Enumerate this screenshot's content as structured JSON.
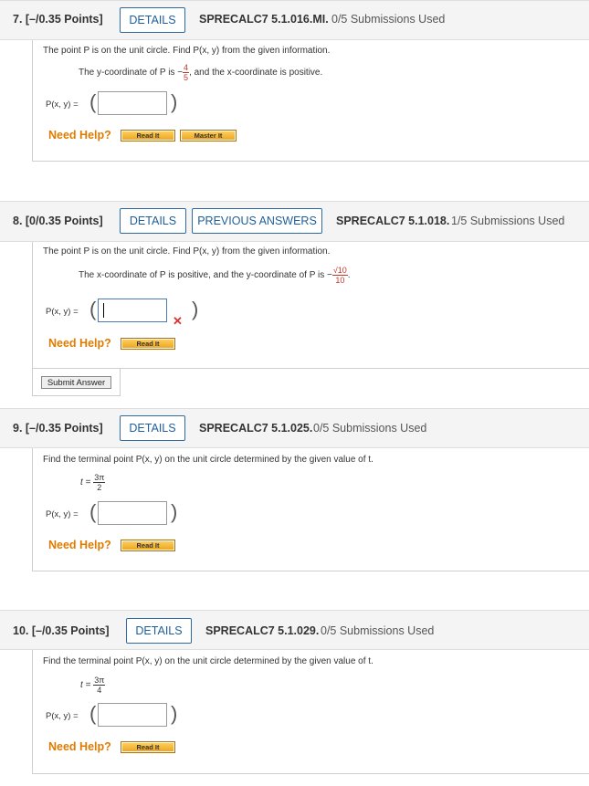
{
  "questions": [
    {
      "number": "7. [–/0.35 Points]",
      "details": "DETAILS",
      "code": "SPRECALC7 5.1.016.MI.",
      "submissions": "0/5 Submissions Used",
      "intro": "The point P is on the unit circle. Find P(x, y) from the given information.",
      "clue_pre": "The y-coordinate of P is  −",
      "clue_num": "4",
      "clue_den": "5",
      "clue_post": ",  and the x-coordinate is positive.",
      "answer_label": "P(x, y) =",
      "help": "Need Help?",
      "read_it": "Read It",
      "master_it": "Master It"
    },
    {
      "number": "8. [0/0.35 Points]",
      "details": "DETAILS",
      "previous": "PREVIOUS ANSWERS",
      "code": "SPRECALC7 5.1.018.",
      "submissions": "1/5 Submissions Used",
      "intro": "The point P is on the unit circle. Find P(x, y) from the given information.",
      "clue_pre": "The x-coordinate of P is positive, and the y-coordinate of P is  −",
      "clue_num": "√10",
      "clue_den": "10",
      "clue_post": ".",
      "answer_label": "P(x, y) =",
      "help": "Need Help?",
      "read_it": "Read It",
      "submit": "Submit Answer"
    },
    {
      "number": "9. [–/0.35 Points]",
      "details": "DETAILS",
      "code": "SPRECALC7 5.1.025.",
      "submissions": "0/5 Submissions Used",
      "intro": "Find the terminal point P(x, y) on the unit circle determined by the given value of t.",
      "t_label": "t =",
      "t_num": "3π",
      "t_den": "2",
      "answer_label": "P(x, y) =",
      "help": "Need Help?",
      "read_it": "Read It"
    },
    {
      "number": "10. [–/0.35 Points]",
      "details": "DETAILS",
      "code": "SPRECALC7 5.1.029.",
      "submissions": "0/5 Submissions Used",
      "intro": "Find the terminal point P(x, y) on the unit circle determined by the given value of t.",
      "t_label": "t =",
      "t_num": "3π",
      "t_den": "4",
      "answer_label": "P(x, y) =",
      "help": "Need Help?",
      "read_it": "Read It"
    }
  ],
  "icons": {
    "incorrect": "x-mark-icon"
  },
  "colors": {
    "help": "#e07b00",
    "link": "#1f5f99",
    "incorrect": "#d33333",
    "fraction": "#c0392b"
  }
}
